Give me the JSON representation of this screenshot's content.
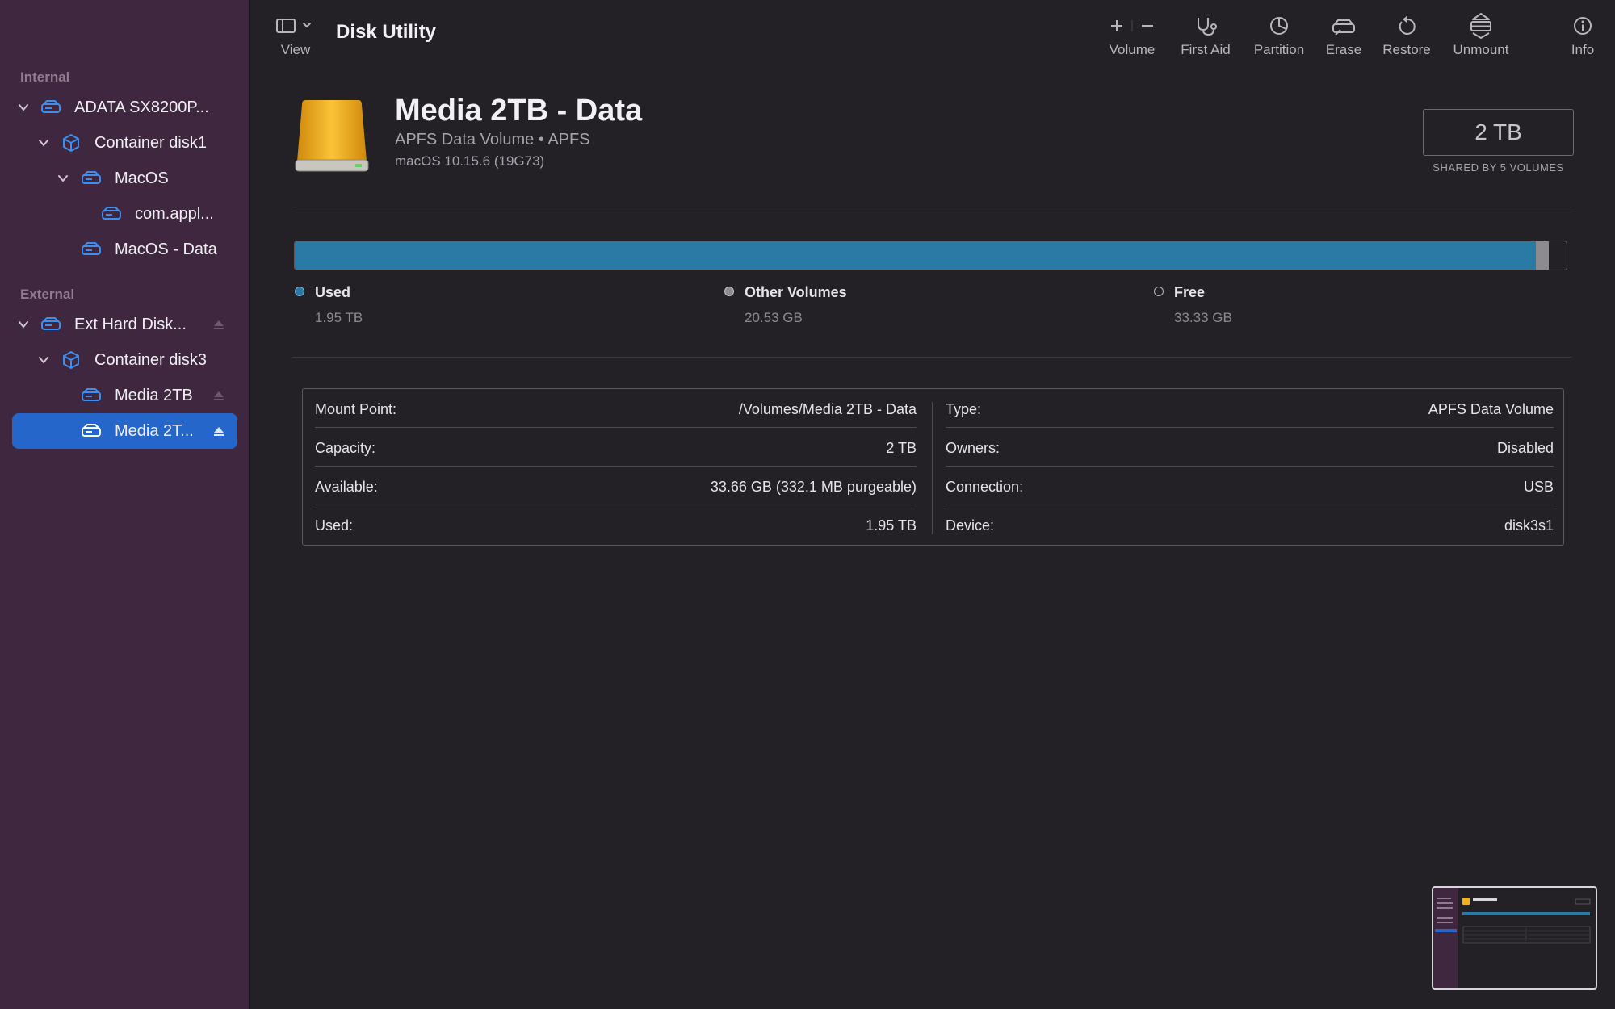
{
  "window": {
    "title": "Disk Utility"
  },
  "colors": {
    "sidebar_bg": "#3f283f",
    "content_bg": "#232026",
    "accent": "#2466c9",
    "used_fill": "#2a7aa5",
    "other_fill": "#8d8a90",
    "icon_blue": "#3e8ef0",
    "drive_gold": "#f3b21d"
  },
  "toolbar": {
    "view_label": "View",
    "volume_label": "Volume",
    "first_aid_label": "First Aid",
    "partition_label": "Partition",
    "erase_label": "Erase",
    "restore_label": "Restore",
    "unmount_label": "Unmount",
    "info_label": "Info"
  },
  "sidebar": {
    "internal_label": "Internal",
    "external_label": "External",
    "items": [
      {
        "label": "ADATA SX8200P...",
        "icon": "internal-disk-icon",
        "expanded": true,
        "ejectable": false
      },
      {
        "label": "Container disk1",
        "icon": "container-icon",
        "expanded": true,
        "ejectable": false
      },
      {
        "label": "MacOS",
        "icon": "volume-icon",
        "expanded": true,
        "ejectable": false
      },
      {
        "label": "com.appl...",
        "icon": "volume-icon",
        "ejectable": false
      },
      {
        "label": "MacOS - Data",
        "icon": "volume-icon",
        "ejectable": false
      },
      {
        "label": "Ext Hard Disk...",
        "icon": "external-disk-icon",
        "expanded": true,
        "ejectable": true
      },
      {
        "label": "Container disk3",
        "icon": "container-icon",
        "expanded": true,
        "ejectable": false
      },
      {
        "label": "Media 2TB",
        "icon": "volume-icon",
        "ejectable": true
      },
      {
        "label": "Media 2T...",
        "icon": "volume-icon",
        "ejectable": true,
        "selected": true
      }
    ]
  },
  "volume": {
    "name": "Media 2TB - Data",
    "subtitle": "APFS Data Volume • APFS",
    "os": "macOS 10.15.6 (19G73)",
    "capacity": "2 TB",
    "capacity_note": "SHARED BY 5 VOLUMES"
  },
  "usage": {
    "used_fraction": 0.976,
    "other_fraction": 0.0102,
    "free_fraction": 0.0138,
    "legend": [
      {
        "name": "Used",
        "value": "1.95 TB",
        "color": "#2a7aa5"
      },
      {
        "name": "Other Volumes",
        "value": "20.53 GB",
        "color": "#8d8a90"
      },
      {
        "name": "Free",
        "value": "33.33 GB",
        "color": "#232026"
      }
    ]
  },
  "info": {
    "left": [
      {
        "key": "Mount Point:",
        "value": "/Volumes/Media 2TB - Data"
      },
      {
        "key": "Capacity:",
        "value": "2 TB"
      },
      {
        "key": "Available:",
        "value": "33.66 GB (332.1 MB purgeable)"
      },
      {
        "key": "Used:",
        "value": "1.95 TB"
      }
    ],
    "right": [
      {
        "key": "Type:",
        "value": "APFS Data Volume"
      },
      {
        "key": "Owners:",
        "value": "Disabled"
      },
      {
        "key": "Connection:",
        "value": "USB"
      },
      {
        "key": "Device:",
        "value": "disk3s1"
      }
    ]
  }
}
